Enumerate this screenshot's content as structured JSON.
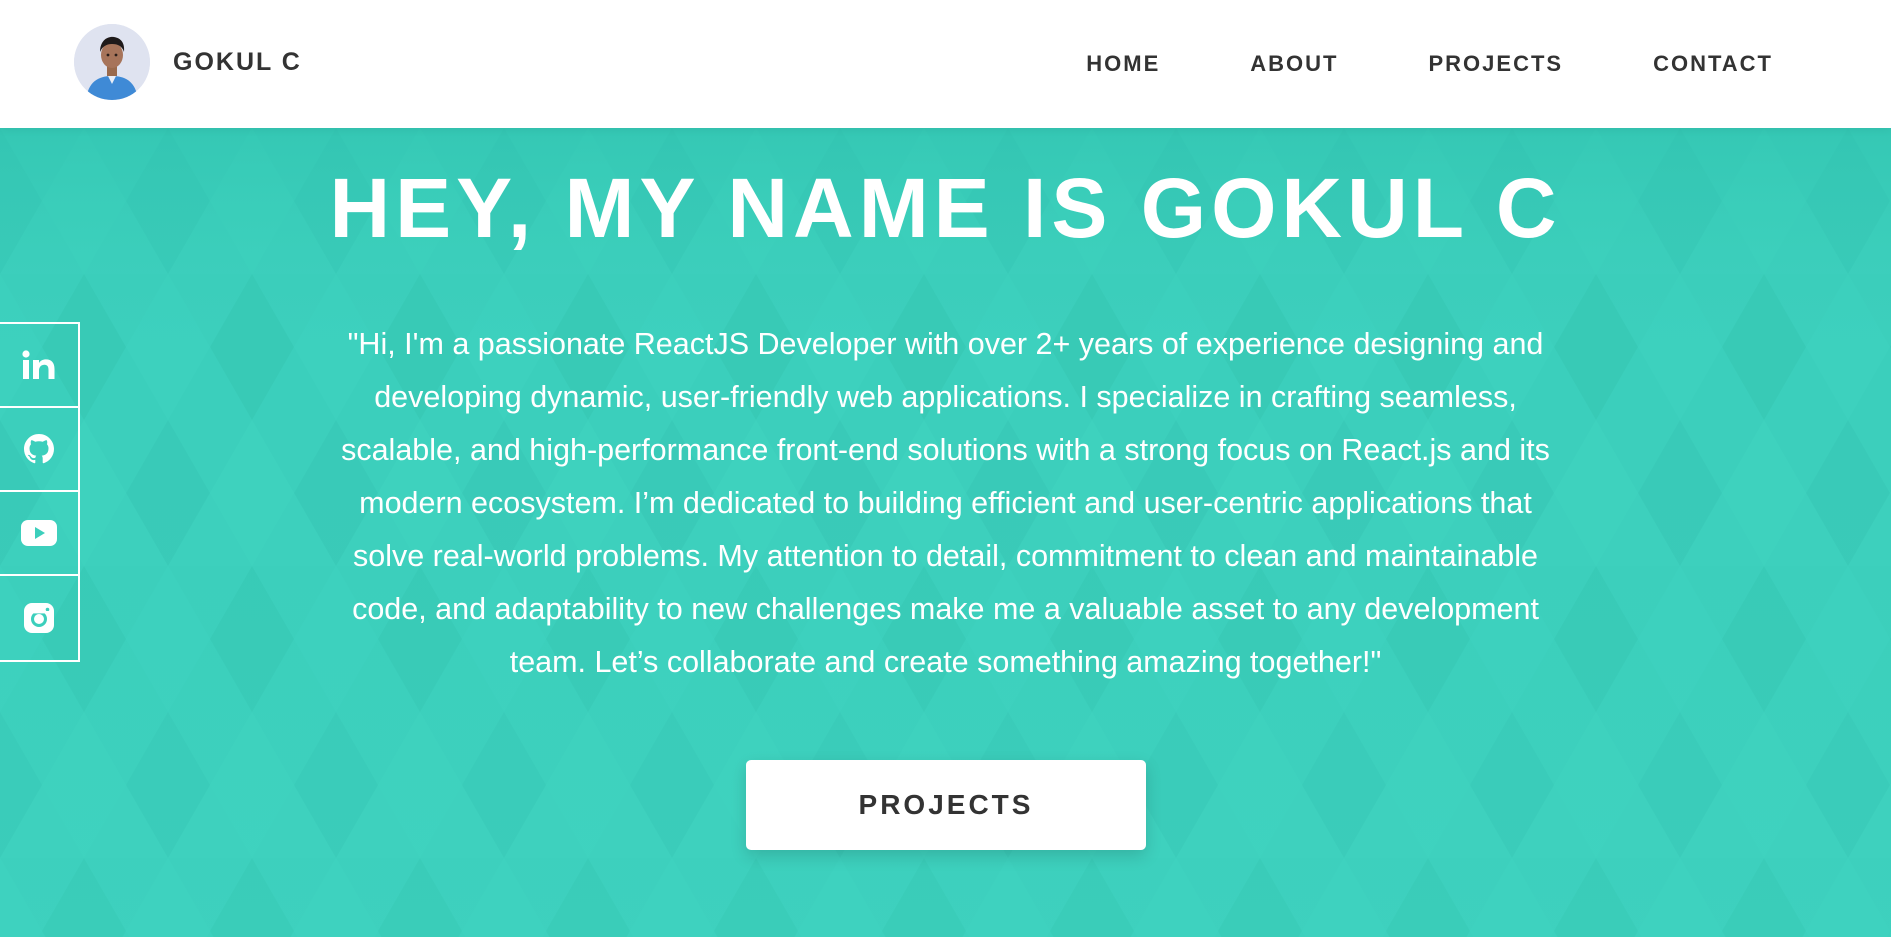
{
  "header": {
    "brand_name": "GOKUL C",
    "avatar_icon": "avatar-photo",
    "nav": [
      {
        "label": "HOME"
      },
      {
        "label": "ABOUT"
      },
      {
        "label": "PROJECTS"
      },
      {
        "label": "CONTACT"
      }
    ]
  },
  "hero": {
    "title": "HEY, MY NAME IS GOKUL C",
    "description": "\"Hi, I'm a passionate ReactJS Developer with over 2+ years of experience designing and developing dynamic, user-friendly web applications. I specialize in crafting seamless, scalable, and high-performance front-end solutions with a strong focus on React.js and its modern ecosystem. I’m dedicated to building efficient and user-centric applications that solve real-world problems. My attention to detail, commitment to clean and maintainable code, and adaptability to new challenges make me a valuable asset to any development team. Let’s collaborate and create something amazing together!\"",
    "cta_label": "PROJECTS"
  },
  "social": [
    {
      "icon": "linkedin-icon"
    },
    {
      "icon": "github-icon"
    },
    {
      "icon": "youtube-icon"
    },
    {
      "icon": "instagram-icon"
    }
  ],
  "colors": {
    "hero_background": "#3ccfbc",
    "header_background": "#ffffff",
    "text_dark": "#333333",
    "text_light": "#ffffff"
  }
}
